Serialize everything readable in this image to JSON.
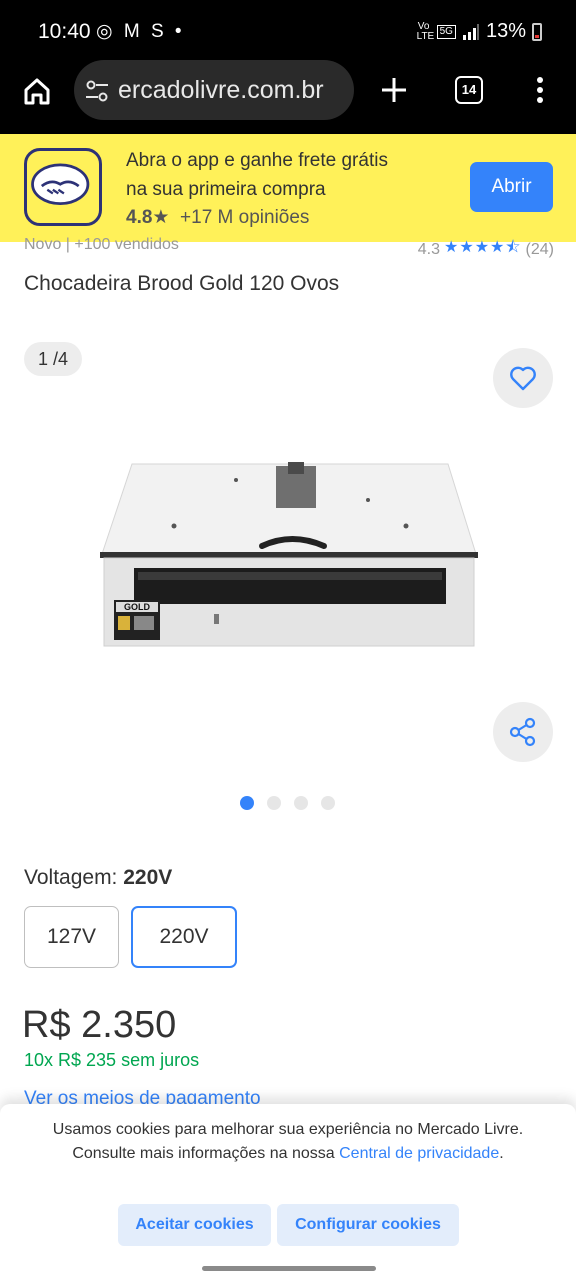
{
  "status_bar": {
    "time": "10:40",
    "left_icons": "◎ M S •",
    "network_top": "Vo LTE",
    "network_5g": "5G",
    "battery": "13%"
  },
  "browser": {
    "url": "ercadolivre.com.br",
    "tab_count": "14"
  },
  "app_banner": {
    "line1": "Abra o app e ganhe frete grátis",
    "line2": "na sua primeira compra",
    "rating": "4.8",
    "reviews": "+17 M opiniões",
    "open_label": "Abrir"
  },
  "meta": {
    "condition": "Novo  |  +100 vendidos",
    "rating": "4.3",
    "stars": "★★★★⯪",
    "reviews": "(24)"
  },
  "product": {
    "title": "Chocadeira Brood Gold 120 Ovos",
    "image_counter": "1 /4",
    "image_brand": "GOLD",
    "dots": [
      {
        "active": true
      },
      {
        "active": false
      },
      {
        "active": false
      },
      {
        "active": false
      }
    ]
  },
  "voltage": {
    "label": "Voltagem: ",
    "selected_value": "220V",
    "options": [
      "127V",
      "220V"
    ]
  },
  "price": {
    "amount": "R$ 2.350",
    "installments": "10x R$ 235 sem juros",
    "payment_link": "Ver os meios de pagamento"
  },
  "cookie": {
    "text": "Usamos cookies para melhorar sua experiência no Mercado Livre. Consulte mais informações na nossa ",
    "link": "Central de privacidade",
    "text_end": ".",
    "accept_label": "Aceitar cookies",
    "configure_label": "Configurar cookies"
  },
  "colors": {
    "brand_yellow": "#fff159",
    "accent_blue": "#3483fa",
    "green": "#00a650"
  }
}
